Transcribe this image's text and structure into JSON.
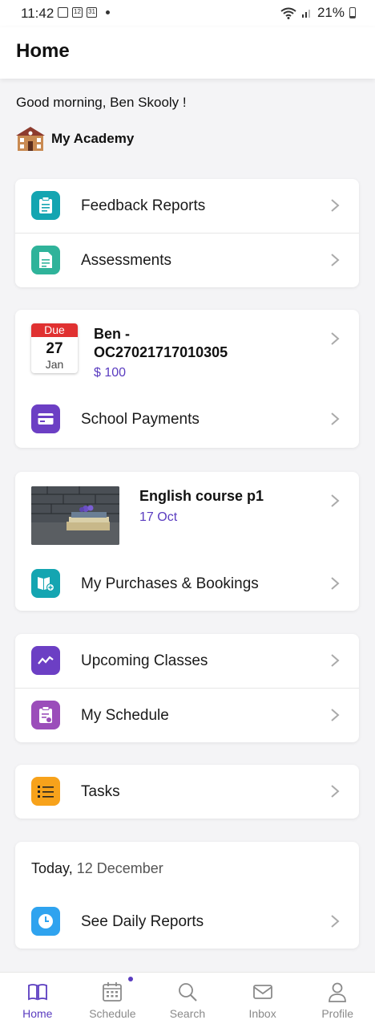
{
  "status": {
    "time": "11:42",
    "battery": "21%",
    "calendar_day": "31",
    "calendar_small": "12"
  },
  "header": {
    "title": "Home"
  },
  "greeting": "Good morning, Ben Skooly !",
  "academy": {
    "name": "My Academy"
  },
  "menu1": [
    {
      "label": "Feedback Reports",
      "icon": "clipboard-icon"
    },
    {
      "label": "Assessments",
      "icon": "document-icon"
    }
  ],
  "payments": {
    "due_label": "Due",
    "due_day": "27",
    "due_month": "Jan",
    "title": "Ben -\nOC27021717010305",
    "amount": "$ 100",
    "link_label": "School Payments"
  },
  "course": {
    "title": "English course p1",
    "date": "17 Oct",
    "link_label": "My Purchases & Bookings"
  },
  "menu2": [
    {
      "label": "Upcoming Classes",
      "icon": "trend-icon"
    },
    {
      "label": "My Schedule",
      "icon": "schedule-icon"
    }
  ],
  "tasks": {
    "label": "Tasks"
  },
  "today": {
    "prefix": "Today,",
    "date": "12 December",
    "link_label": "See Daily Reports"
  },
  "nav": [
    {
      "label": "Home",
      "icon": "book-icon",
      "active": true
    },
    {
      "label": "Schedule",
      "icon": "calendar-icon",
      "active": false
    },
    {
      "label": "Search",
      "icon": "search-icon",
      "active": false
    },
    {
      "label": "Inbox",
      "icon": "inbox-icon",
      "active": false
    },
    {
      "label": "Profile",
      "icon": "profile-icon",
      "active": false
    }
  ],
  "colors": {
    "accent": "#5a3cc0",
    "due_red": "#e03131",
    "teal": "#14a5b1",
    "orange": "#f7a21b"
  }
}
